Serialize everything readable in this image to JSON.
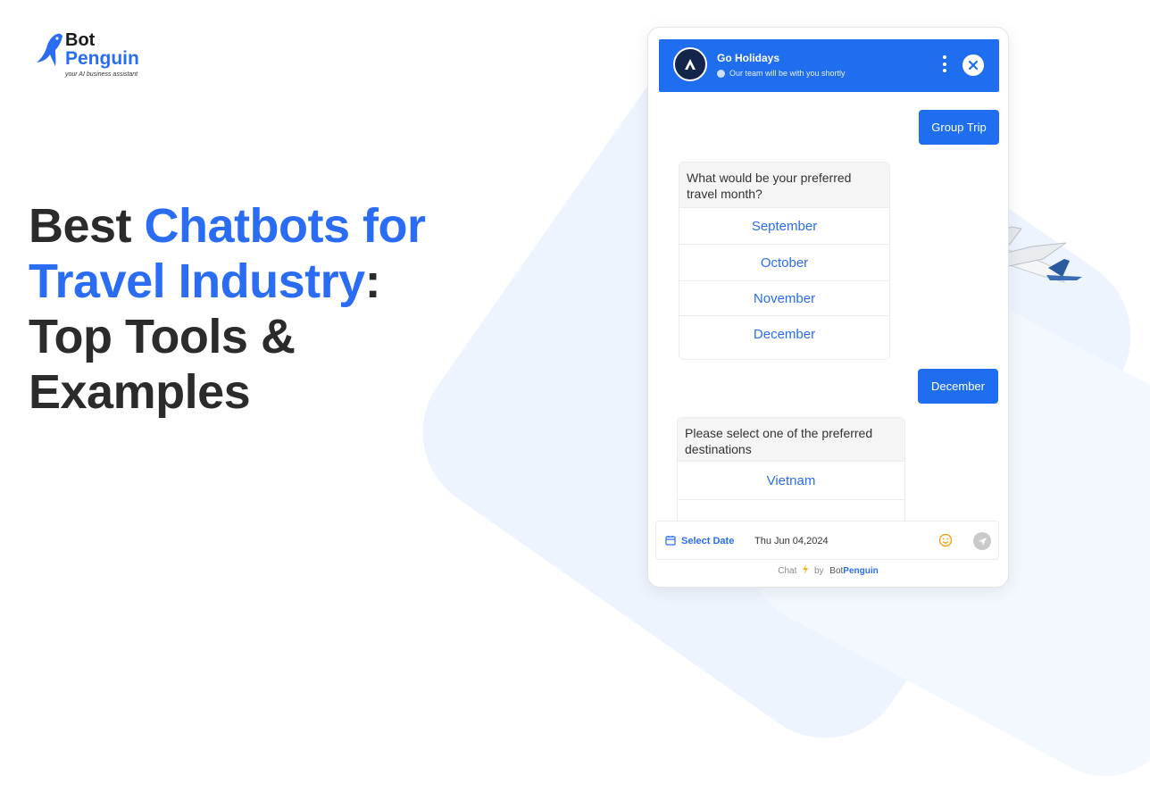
{
  "logo": {
    "line1": "Bot",
    "line2": "Penguin",
    "tagline": "your AI business assistant"
  },
  "headline": {
    "part1": "Best ",
    "part2_blue": "Chatbots for",
    "part3_blue": "Travel Industry",
    "part4": ":",
    "line3": "Top Tools &",
    "line4": "Examples"
  },
  "chat": {
    "header": {
      "bot_name": "Go Holidays",
      "status": "Our team will be with you shortly",
      "avatar_letter": "A"
    },
    "messages": {
      "user1": "Group Trip",
      "bot1_question": "What would be your preferred travel month?",
      "bot1_options": [
        "September",
        "October",
        "November",
        "December"
      ],
      "user2": "December",
      "bot2_question": "Please select one of the preferred destinations",
      "bot2_options": [
        "Vietnam"
      ]
    },
    "input": {
      "select_date_label": "Select Date",
      "date_value": "Thu Jun 04,2024"
    },
    "footer": {
      "chat": "Chat",
      "by": "by",
      "brand_bot": "Bot",
      "brand_penguin": "Penguin"
    }
  },
  "colors": {
    "brand_blue": "#2a6df4",
    "header_blue": "#1f6ef0",
    "text_dark": "#2b2b2b"
  }
}
